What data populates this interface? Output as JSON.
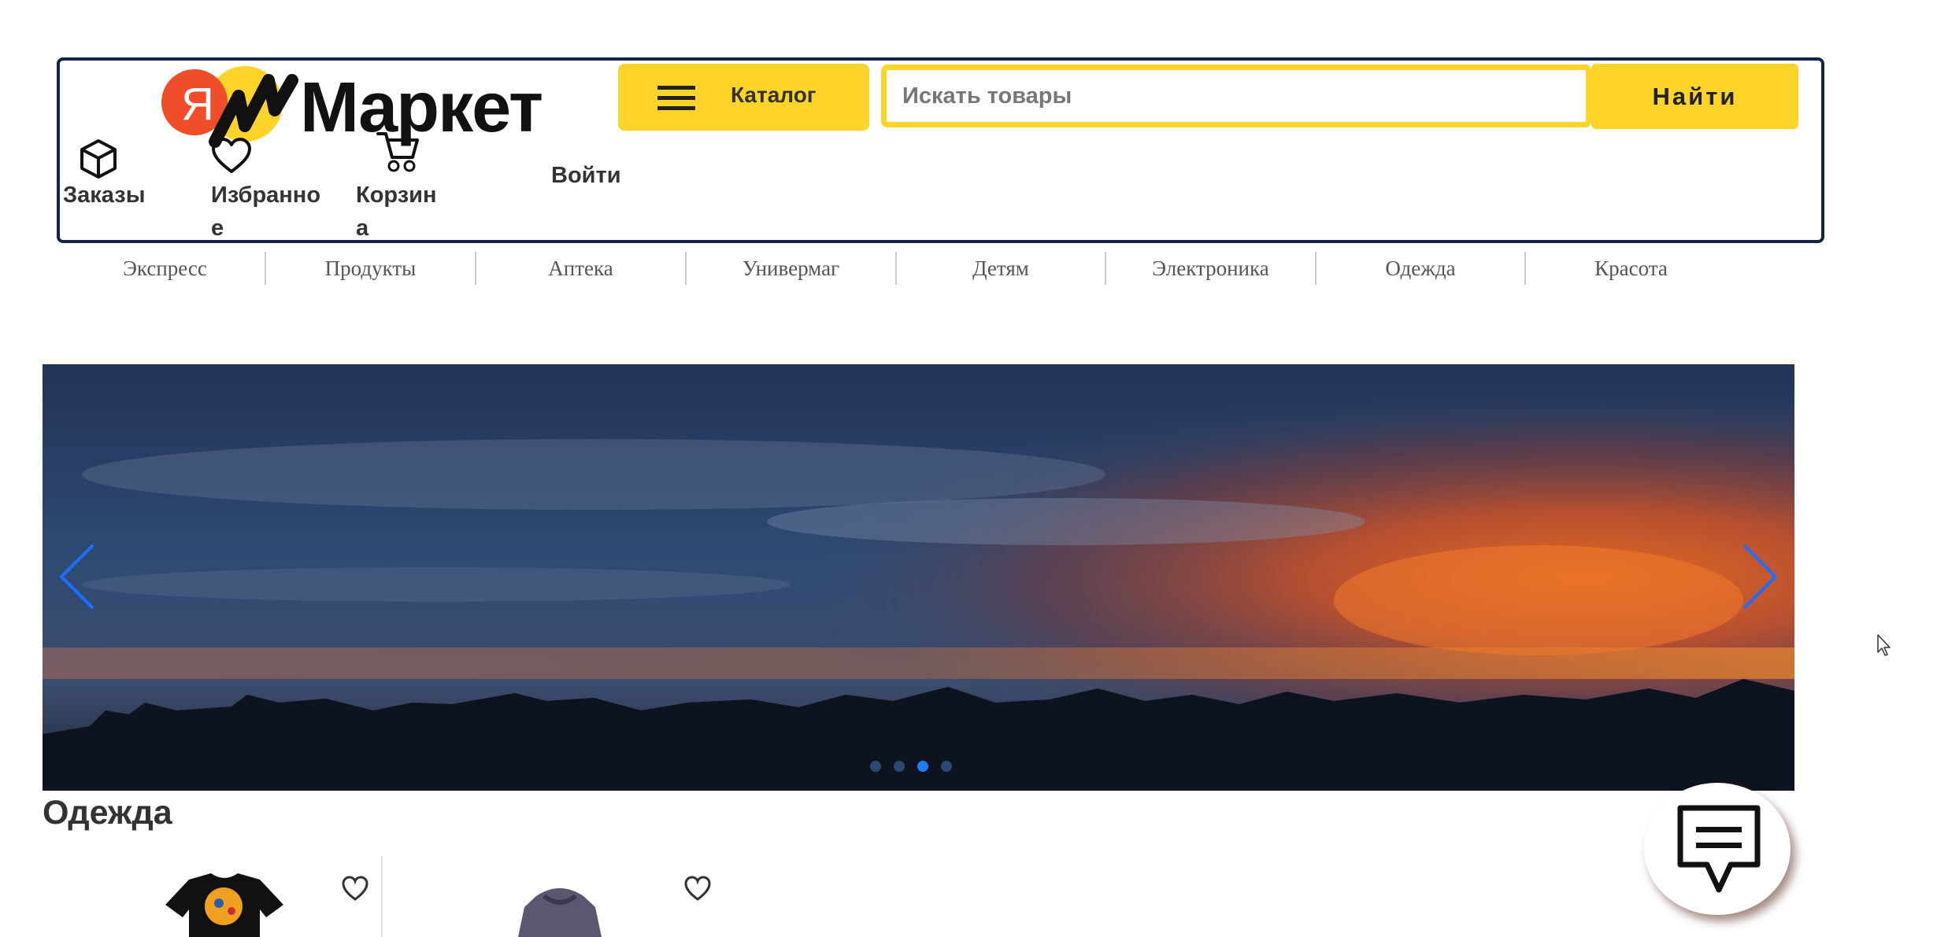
{
  "header": {
    "logo_text": "Маркет",
    "logo_badge": "Я",
    "catalog_label": "Каталог",
    "search_placeholder": "Искать товары",
    "search_button": "Найти",
    "orders_label": "Заказы",
    "favorites_line1": "Избранно",
    "favorites_line2": "е",
    "cart_line1": "Корзин",
    "cart_line2": "а",
    "login_label": "Войти"
  },
  "categories": [
    "Экспресс",
    "Продукты",
    "Аптека",
    "Универмаг",
    "Детям",
    "Электроника",
    "Одежда",
    "Красота"
  ],
  "carousel": {
    "slides": 4,
    "active_index": 2
  },
  "section": {
    "title": "Одежда"
  },
  "colors": {
    "accent": "#fed42b",
    "border": "#16244a",
    "arrow": "#1e6fff"
  }
}
